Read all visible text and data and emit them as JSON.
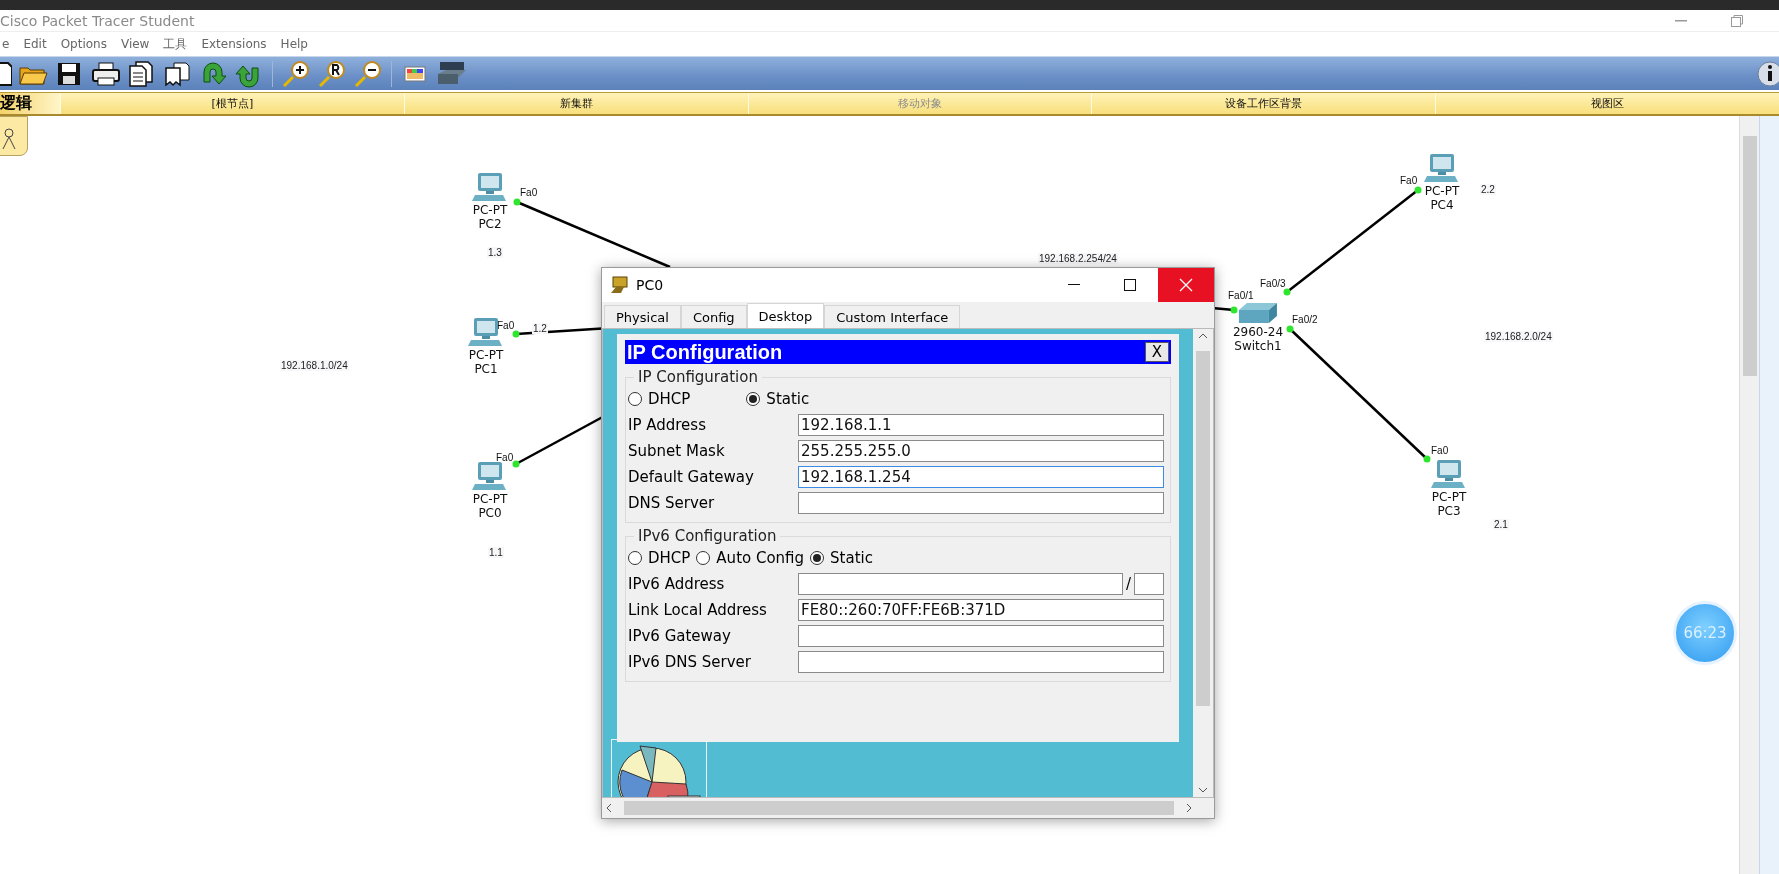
{
  "app": {
    "title": "Cisco Packet Tracer Student"
  },
  "menu": [
    {
      "label": "e"
    },
    {
      "label": "Edit"
    },
    {
      "label": "Options"
    },
    {
      "label": "View"
    },
    {
      "label": "工具"
    },
    {
      "label": "Extensions"
    },
    {
      "label": "Help"
    }
  ],
  "workspace_bar": {
    "mode": "逻辑",
    "items": [
      {
        "label": "[根节点]",
        "disabled": false
      },
      {
        "label": "新集群",
        "disabled": false
      },
      {
        "label": "移动对象",
        "disabled": true
      },
      {
        "label": "设备工作区背景",
        "disabled": false
      },
      {
        "label": "视图区",
        "disabled": false
      }
    ]
  },
  "topology": {
    "devices": [
      {
        "kind": "pc",
        "model": "PC-PT",
        "name": "PC2"
      },
      {
        "kind": "pc",
        "model": "PC-PT",
        "name": "PC1"
      },
      {
        "kind": "pc",
        "model": "PC-PT",
        "name": "PC0"
      },
      {
        "kind": "switch",
        "model": "2960-24",
        "name": "Switch1"
      },
      {
        "kind": "pc",
        "model": "PC-PT",
        "name": "PC4"
      },
      {
        "kind": "pc",
        "model": "PC-PT",
        "name": "PC3"
      }
    ],
    "ports": [
      "Fa0",
      "Fa0",
      "Fa0",
      "Fa0/1",
      "Fa0/3",
      "Fa0/2",
      "Fa0",
      "Fa0"
    ],
    "notes": [
      "1.3",
      "1.2",
      "192.168.1.0/24",
      "1.1",
      "192.168.2.254/24",
      "2.2",
      "192.168.2.0/24",
      "2.1"
    ]
  },
  "timer": "66:23",
  "dialog": {
    "title": "PC0",
    "tabs": [
      {
        "label": "Physical",
        "selected": false
      },
      {
        "label": "Config",
        "selected": false
      },
      {
        "label": "Desktop",
        "selected": true
      },
      {
        "label": "Custom Interface",
        "selected": false
      }
    ],
    "panel": {
      "title": "IP Configuration",
      "close_label": "X",
      "ipv4": {
        "legend": "IP Configuration",
        "modes": [
          {
            "label": "DHCP",
            "selected": false
          },
          {
            "label": "Static",
            "selected": true
          }
        ],
        "fields": [
          {
            "kind": "plain",
            "label": "IP Address",
            "value": "192.168.1.1",
            "focused": false
          },
          {
            "kind": "plain",
            "label": "Subnet Mask",
            "value": "255.255.255.0",
            "focused": false
          },
          {
            "kind": "plain",
            "label": "Default Gateway",
            "value": "192.168.1.254",
            "focused": true
          },
          {
            "kind": "plain",
            "label": "DNS Server",
            "focused": false
          }
        ]
      },
      "ipv6": {
        "legend": "IPv6 Configuration",
        "modes": [
          {
            "label": "DHCP",
            "selected": false
          },
          {
            "label": "Auto Config",
            "selected": false
          },
          {
            "label": "Static",
            "selected": true
          }
        ],
        "fields": [
          {
            "kind": "prefixed",
            "label": "IPv6 Address",
            "separator": "/",
            "focused": false
          },
          {
            "kind": "plain",
            "label": "Link Local Address",
            "value": "FE80::260:70FF:FE6B:371D",
            "focused": false
          },
          {
            "kind": "plain",
            "label": "IPv6 Gateway",
            "focused": false
          },
          {
            "kind": "plain",
            "label": "IPv6 DNS Server",
            "focused": false
          }
        ]
      }
    }
  }
}
